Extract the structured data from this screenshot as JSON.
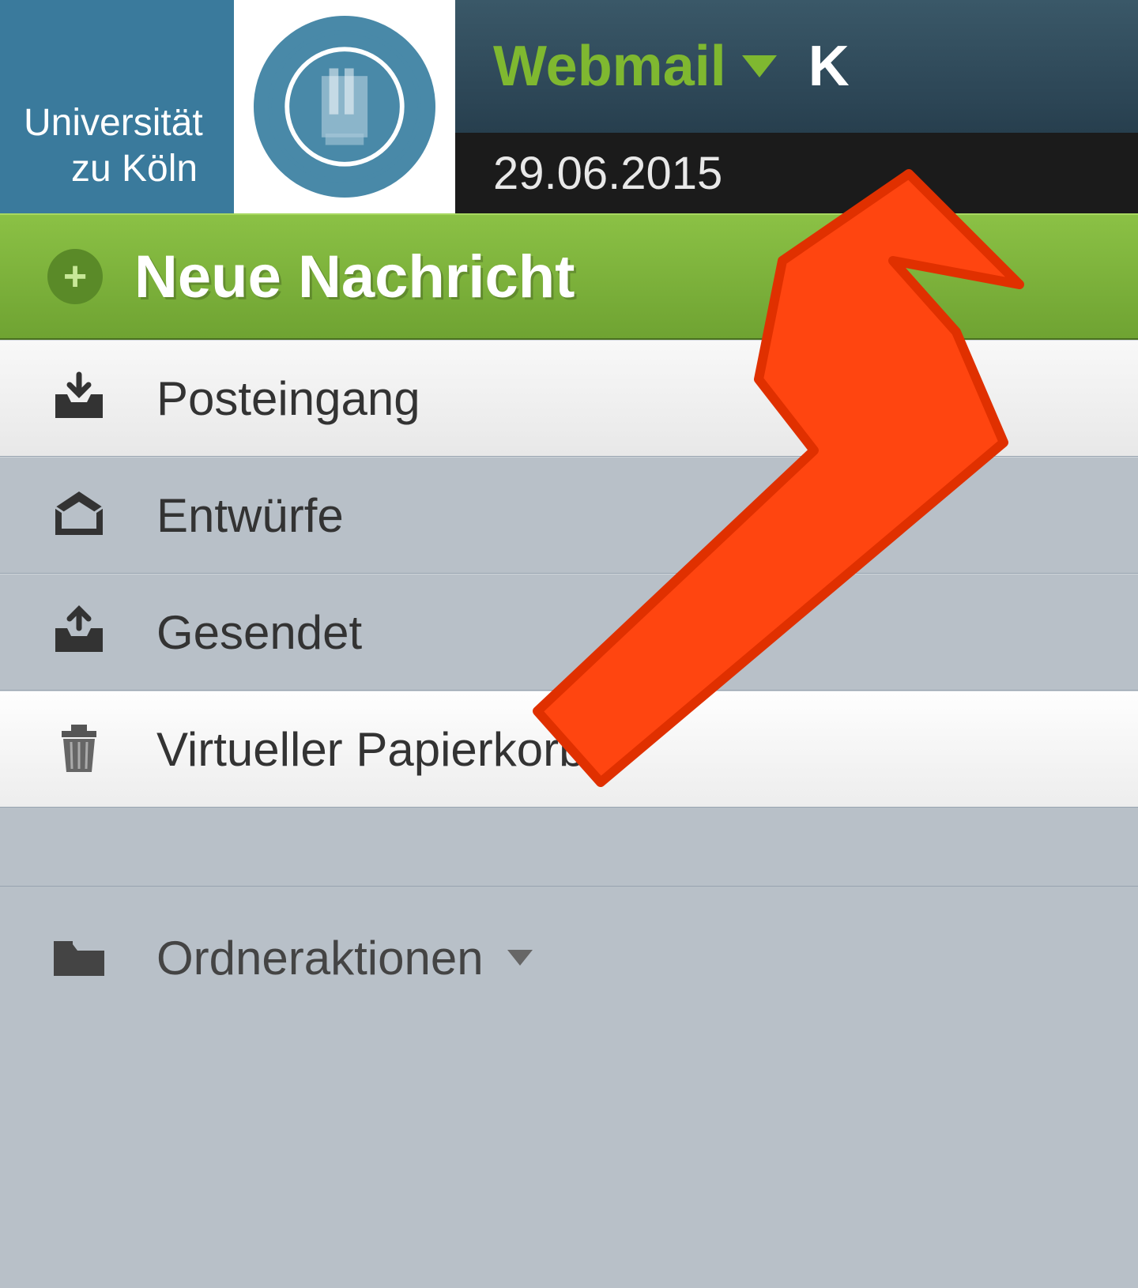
{
  "logo": {
    "line1": "Universität",
    "line2": "zu Köln"
  },
  "nav": {
    "active_tab": "Webmail",
    "other_tab": "K"
  },
  "date": "29.06.2015",
  "new_message": "Neue Nachricht",
  "folders": {
    "inbox": "Posteingang",
    "drafts": "Entwürfe",
    "sent": "Gesendet",
    "trash": "Virtueller Papierkorb"
  },
  "folder_actions": "Ordneraktionen"
}
